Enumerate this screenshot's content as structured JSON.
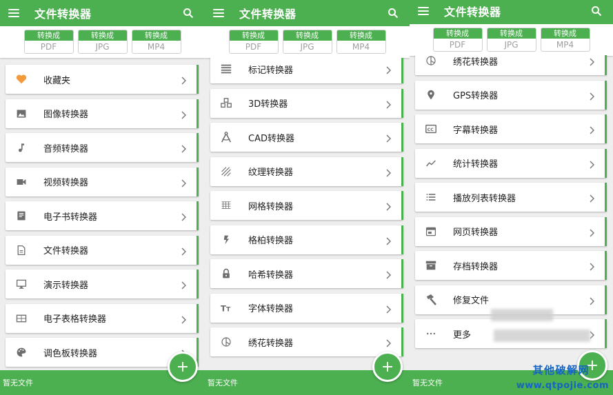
{
  "app_title": "文件转换器",
  "convert_chips": [
    {
      "top": "转换成",
      "bottom": "PDF"
    },
    {
      "top": "转换成",
      "bottom": "JPG"
    },
    {
      "top": "转换成",
      "bottom": "MP4"
    }
  ],
  "panel1_items": [
    {
      "label": "收藏夹",
      "icon": "heart-icon"
    },
    {
      "label": "图像转换器",
      "icon": "image-icon"
    },
    {
      "label": "音频转换器",
      "icon": "music-note-icon"
    },
    {
      "label": "视频转换器",
      "icon": "videocam-icon"
    },
    {
      "label": "电子书转换器",
      "icon": "book-icon"
    },
    {
      "label": "文件转换器",
      "icon": "document-icon"
    },
    {
      "label": "演示转换器",
      "icon": "monitor-icon"
    },
    {
      "label": "电子表格转换器",
      "icon": "spreadsheet-icon"
    },
    {
      "label": "调色板转换器",
      "icon": "palette-icon"
    }
  ],
  "panel2_items": [
    {
      "label": "标记转换器",
      "icon": "markup-lines-icon"
    },
    {
      "label": "3D转换器",
      "icon": "cubes-icon"
    },
    {
      "label": "CAD转换器",
      "icon": "compass-icon"
    },
    {
      "label": "纹理转换器",
      "icon": "texture-icon"
    },
    {
      "label": "网格转换器",
      "icon": "grid-icon"
    },
    {
      "label": "格柏转换器",
      "icon": "bolt-icon"
    },
    {
      "label": "哈希转换器",
      "icon": "lock-icon"
    },
    {
      "label": "字体转换器",
      "icon": "font-size-icon"
    },
    {
      "label": "绣花转换器",
      "icon": "embroidery-icon"
    }
  ],
  "panel3_items": [
    {
      "label": "绣花转换器",
      "icon": "embroidery-icon"
    },
    {
      "label": "GPS转换器",
      "icon": "location-pin-icon"
    },
    {
      "label": "字幕转换器",
      "icon": "closed-caption-icon"
    },
    {
      "label": "统计转换器",
      "icon": "trend-icon"
    },
    {
      "label": "播放列表转换器",
      "icon": "list-icon"
    },
    {
      "label": "网页转换器",
      "icon": "webpage-icon"
    },
    {
      "label": "存档转换器",
      "icon": "archive-icon"
    },
    {
      "label": "修复文件",
      "icon": "hammer-icon"
    },
    {
      "label": "更多",
      "icon": "more-dots-icon"
    }
  ],
  "status_text": "暂无文件",
  "fab_label": "+",
  "watermark": {
    "line1": "其他破解网",
    "line2": "www.qtpojie.com"
  },
  "colors": {
    "accent": "#4caf50",
    "icon_gray": "#6d6d6d",
    "heart": "#f39a3d"
  }
}
